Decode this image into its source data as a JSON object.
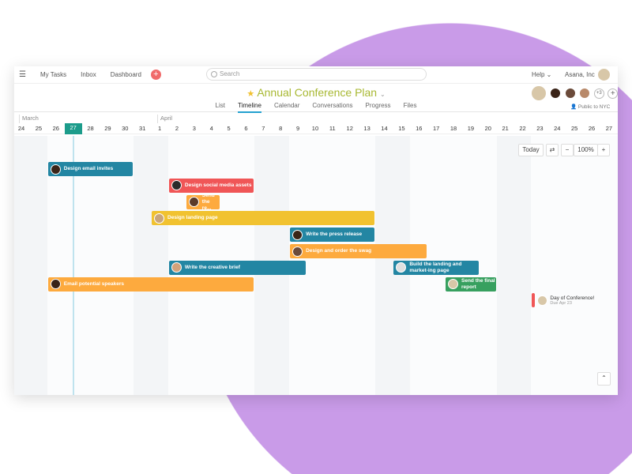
{
  "topbar": {
    "nav": [
      "My Tasks",
      "Inbox",
      "Dashboard"
    ],
    "search_placeholder": "Search",
    "help": "Help",
    "org": "Asana, Inc"
  },
  "project": {
    "title": "Annual Conference Plan",
    "tabs": [
      "List",
      "Timeline",
      "Calendar",
      "Conversations",
      "Progress",
      "Files"
    ],
    "active_tab": "Timeline",
    "members_more": "+3",
    "privacy": "Public to NYC"
  },
  "timeline": {
    "months": [
      {
        "label": "March",
        "day_index": 0
      },
      {
        "label": "April",
        "day_index": 8
      }
    ],
    "days": [
      "24",
      "25",
      "26",
      "27",
      "28",
      "29",
      "30",
      "31",
      "1",
      "2",
      "3",
      "4",
      "5",
      "6",
      "7",
      "8",
      "9",
      "10",
      "11",
      "12",
      "13",
      "14",
      "15",
      "16",
      "17",
      "18",
      "19",
      "20",
      "21",
      "22",
      "23",
      "24",
      "25",
      "26",
      "27"
    ],
    "today_index": 3,
    "weekend_indices": [
      0,
      1,
      7,
      8,
      14,
      15,
      21,
      22,
      28,
      29
    ],
    "controls": {
      "today": "Today",
      "zoom": "100%",
      "minus": "−",
      "plus": "+"
    },
    "tasks": [
      {
        "name": "Design email invites",
        "start": 2,
        "end": 6,
        "row": 0,
        "color": "#2386a3"
      },
      {
        "name": "Design social media assets",
        "start": 9,
        "end": 13,
        "row": 1,
        "color": "#f05657"
      },
      {
        "name": "Send the re...",
        "start": 10,
        "end": 11,
        "row": 2,
        "color": "#fdaa3e"
      },
      {
        "name": "Design landing page",
        "start": 8,
        "end": 20,
        "row": 3,
        "color": "#f1c230"
      },
      {
        "name": "Write the press release",
        "start": 16,
        "end": 20,
        "row": 4,
        "color": "#2386a3"
      },
      {
        "name": "Design and order the swag",
        "start": 16,
        "end": 23,
        "row": 5,
        "color": "#fdaa3e"
      },
      {
        "name": "Write the creative brief",
        "start": 9,
        "end": 16,
        "row": 6,
        "color": "#2386a3"
      },
      {
        "name": "Build the landing and market-ing page",
        "start": 22,
        "end": 26,
        "row": 6,
        "color": "#2386a3"
      },
      {
        "name": "Email potential speakers",
        "start": 2,
        "end": 13,
        "row": 7,
        "color": "#fdaa3e"
      },
      {
        "name": "Send the final report",
        "start": 25,
        "end": 27,
        "row": 7,
        "color": "#37a05f"
      }
    ],
    "milestone": {
      "name": "Day of Conference!",
      "due": "Due Apr 23",
      "day_index": 30,
      "color": "#f05657"
    }
  }
}
